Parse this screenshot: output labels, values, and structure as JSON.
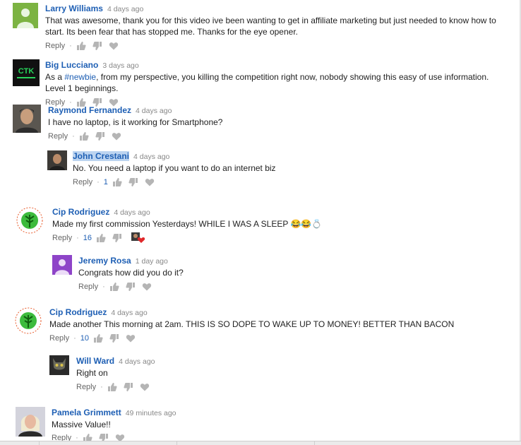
{
  "comments": [
    {
      "author": "Larry Williams",
      "time": "4 days ago",
      "text": "That was awesome, thank you for this video ive been wanting to get in affiliate marketing but just needed to know how to start.  Its been fear that has stopped me. Thanks for the eye opener.",
      "reply": "Reply",
      "likes": ""
    },
    {
      "author": "Big Lucciano",
      "time": "3 days ago",
      "text_pre": "As a ",
      "tag": "#newbie",
      "text_post": ", from my perspective, you killing the competition right now, nobody showing this easy of use information. Level 1 beginnings.",
      "reply": "Reply",
      "likes": "",
      "avatar_text": "CTK"
    },
    {
      "author": "Raymond Fernandez",
      "time": "4 days ago",
      "text": "I have no laptop, is it working for Smartphone?",
      "reply": "Reply",
      "likes": ""
    },
    {
      "author": "John Crestani",
      "time": "4 days ago",
      "text": "No. You need a laptop if you want to do an internet biz",
      "reply": "Reply",
      "likes": "1"
    },
    {
      "author": "Cip Rodriguez",
      "time": "4 days ago",
      "text": "Made my first commission Yesterdays! WHILE I WAS A SLEEP 😂😂💍",
      "reply": "Reply",
      "likes": "16"
    },
    {
      "author": "Jeremy Rosa",
      "time": "1 day ago",
      "text": "Congrats how did you do it?",
      "reply": "Reply",
      "likes": ""
    },
    {
      "author": "Cip Rodriguez",
      "time": "4 days ago",
      "text": "Made another This morning at 2am. THIS IS SO DOPE TO WAKE UP TO MONEY! BETTER THAN BACON",
      "reply": "Reply",
      "likes": "10"
    },
    {
      "author": "Will Ward",
      "time": "4 days ago",
      "text": "Right on",
      "reply": "Reply",
      "likes": ""
    },
    {
      "author": "Pamela Grimmett",
      "time": "49 minutes ago",
      "text": "Massive Value!!",
      "reply": "Reply",
      "likes": ""
    }
  ],
  "colors": {
    "link": "#1e5fb4",
    "muted": "#888888",
    "highlight": "#bcd4f0"
  }
}
